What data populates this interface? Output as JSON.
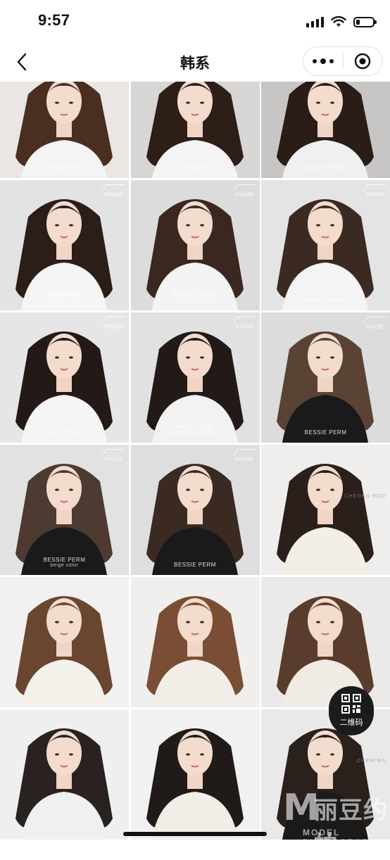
{
  "status": {
    "time": "9:57"
  },
  "nav": {
    "title": "韩系"
  },
  "tiles": [
    {
      "caption": "WEDDING",
      "sub": "",
      "logo": ""
    },
    {
      "caption": "WEDDING",
      "sub": "",
      "logo": ""
    },
    {
      "caption": "LAURA PERM",
      "sub": "",
      "logo": ""
    },
    {
      "caption": "LAURA PERM",
      "sub": "beige color",
      "logo": "HAUM"
    },
    {
      "caption": "BEAUTY PERM",
      "sub": "velvet brown",
      "logo": "HAUM"
    },
    {
      "caption": "BEAUTY PERM",
      "sub": "",
      "logo": "HAUM"
    },
    {
      "caption": "RAPE PERM",
      "sub": "",
      "logo": "HAUM"
    },
    {
      "caption": "RAPE PERM",
      "sub": "lavender beige color",
      "logo": "HAUM"
    },
    {
      "caption": "BESSIE PERM",
      "sub": "",
      "logo": "HAUM"
    },
    {
      "caption": "BESSIE PERM",
      "sub": "beige color",
      "logo": "HAUM"
    },
    {
      "caption": "BESSIE PERM",
      "sub": "",
      "logo": "HAUM"
    },
    {
      "caption": "",
      "sub": "",
      "logo": ""
    },
    {
      "caption": "",
      "sub": "",
      "logo": ""
    },
    {
      "caption": "",
      "sub": "",
      "logo": ""
    },
    {
      "caption": "",
      "sub": "",
      "logo": ""
    },
    {
      "caption": "",
      "sub": "",
      "logo": ""
    },
    {
      "caption": "",
      "sub": "",
      "logo": ""
    },
    {
      "caption": "",
      "sub": "",
      "logo": ""
    }
  ],
  "watermarks": {
    "tile12": "CHEONG ROO",
    "tile17": "CHEWING"
  },
  "qr": {
    "label": "二维码"
  },
  "corner": {
    "cn": "丽豆约拍",
    "en": "MODEL PHOTOGRAPH"
  },
  "colors": {
    "hairDark": "#2a1d18",
    "hairBrown": "#5a3a2a",
    "skin": "#f1d6c8",
    "bgGray": "#d9d9d9"
  }
}
